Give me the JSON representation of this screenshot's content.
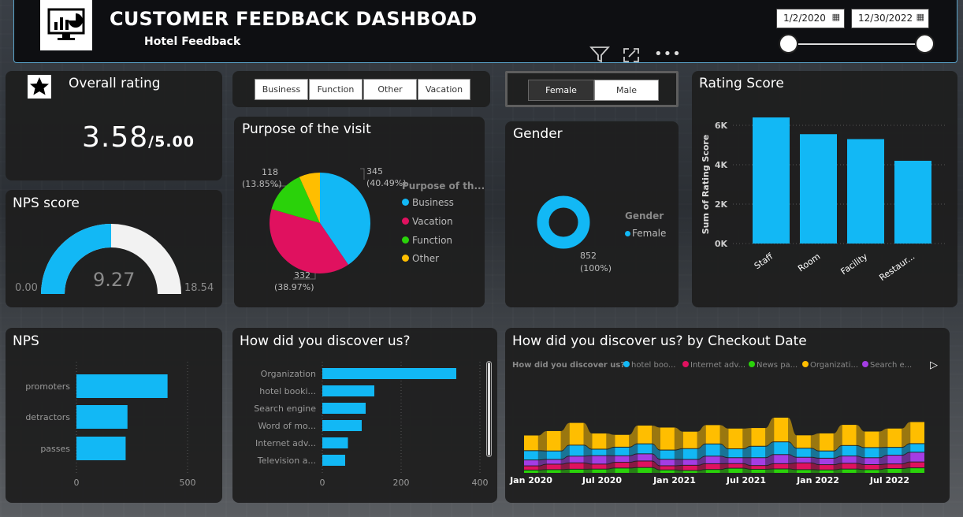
{
  "header": {
    "title": "CUSTOMER FEEDBACK DASHBOAD",
    "subtitle": "Hotel Feedback",
    "date_start": "1/2/2020",
    "date_end": "12/30/2022"
  },
  "overall": {
    "title": "Overall rating",
    "value": "3.58",
    "suffix": "/5.00"
  },
  "nps_score": {
    "title": "NPS score",
    "value": "9.27",
    "min": "0.00",
    "max": "18.54"
  },
  "purpose_slicer": [
    "Business",
    "Function",
    "Other",
    "Vacation"
  ],
  "gender_slicer": [
    "Female",
    "Male"
  ],
  "purpose": {
    "title": "Purpose of the visit",
    "legend_title": "Purpose of th...",
    "labels": {
      "business": {
        "count": "345",
        "pct": "(40.49%)"
      },
      "vacation": {
        "count": "332",
        "pct": "(38.97%)"
      },
      "function": {
        "count": "118",
        "pct": "(13.85%)"
      }
    },
    "legend": [
      "Business",
      "Vacation",
      "Function",
      "Other"
    ]
  },
  "gender": {
    "title": "Gender",
    "legend_title": "Gender",
    "legend": [
      "Female"
    ],
    "label_count": "852",
    "label_pct": "(100%)"
  },
  "rating": {
    "title": "Rating Score",
    "ylabel": "Sum of Rating Score",
    "yticks": [
      "6K",
      "4K",
      "2K",
      "0K"
    ],
    "categories": [
      "Staff",
      "Room",
      "Facility",
      "Restaur..."
    ]
  },
  "nps": {
    "title": "NPS",
    "categories": [
      "promoters",
      "detractors",
      "passes"
    ],
    "xticks": [
      "0",
      "500"
    ]
  },
  "discover": {
    "title": "How did you discover us?",
    "categories": [
      "Organization",
      "hotel booki...",
      "Search engine",
      "Word of mo...",
      "Internet adv...",
      "Television a..."
    ],
    "xticks": [
      "0",
      "200",
      "400"
    ]
  },
  "discover_date": {
    "title": "How did you discover us? by Checkout Date",
    "legend_title": "How did you discover us?",
    "legend": [
      "hotel boo...",
      "Internet adv...",
      "News pa...",
      "Organizati...",
      "Search e..."
    ],
    "xticks": [
      "Jan 2020",
      "Jul 2020",
      "Jan 2021",
      "Jul 2021",
      "Jan 2022",
      "Jul 2022"
    ]
  },
  "colors": {
    "blue": "#12b8f5",
    "pink": "#e0115f",
    "green": "#2ad20a",
    "yellow": "#ffbe00",
    "purple": "#a43de4",
    "gray": "#8d8d8d"
  },
  "chart_data": [
    {
      "type": "pie",
      "title": "Purpose of the visit",
      "categories": [
        "Business",
        "Vacation",
        "Function",
        "Other"
      ],
      "values": [
        345,
        332,
        118,
        57
      ]
    },
    {
      "type": "pie",
      "title": "Gender",
      "categories": [
        "Female"
      ],
      "values": [
        852
      ]
    },
    {
      "type": "bar",
      "title": "Rating Score",
      "categories": [
        "Staff",
        "Room",
        "Facility",
        "Restaur..."
      ],
      "values": [
        6400,
        5550,
        5300,
        4200
      ],
      "ylabel": "Sum of Rating Score",
      "ylim": [
        0,
        7000
      ]
    },
    {
      "type": "bar",
      "title": "NPS",
      "categories": [
        "promoters",
        "detractors",
        "passes"
      ],
      "values": [
        500,
        280,
        270
      ],
      "xlim": [
        0,
        620
      ]
    },
    {
      "type": "bar",
      "title": "How did you discover us?",
      "categories": [
        "Organization",
        "hotel booki...",
        "Search engine",
        "Word of mo...",
        "Internet adv...",
        "Television a..."
      ],
      "values": [
        340,
        132,
        110,
        100,
        65,
        58
      ],
      "xlim": [
        0,
        400
      ]
    },
    {
      "type": "area",
      "title": "How did you discover us? by Checkout Date",
      "x": [
        "Jan 2020",
        "Jul 2020",
        "Jan 2021",
        "Jul 2021",
        "Jan 2022",
        "Jul 2022"
      ],
      "series": [
        {
          "name": "hotel boo...",
          "values": [
            12,
            10,
            14,
            12,
            13,
            11
          ]
        },
        {
          "name": "Internet adv...",
          "values": [
            6,
            7,
            5,
            6,
            7,
            6
          ]
        },
        {
          "name": "News pa...",
          "values": [
            4,
            5,
            4,
            5,
            4,
            5
          ]
        },
        {
          "name": "Organizati...",
          "values": [
            22,
            24,
            26,
            28,
            22,
            26
          ]
        },
        {
          "name": "Search e...",
          "values": [
            8,
            9,
            8,
            9,
            8,
            9
          ]
        }
      ]
    }
  ]
}
